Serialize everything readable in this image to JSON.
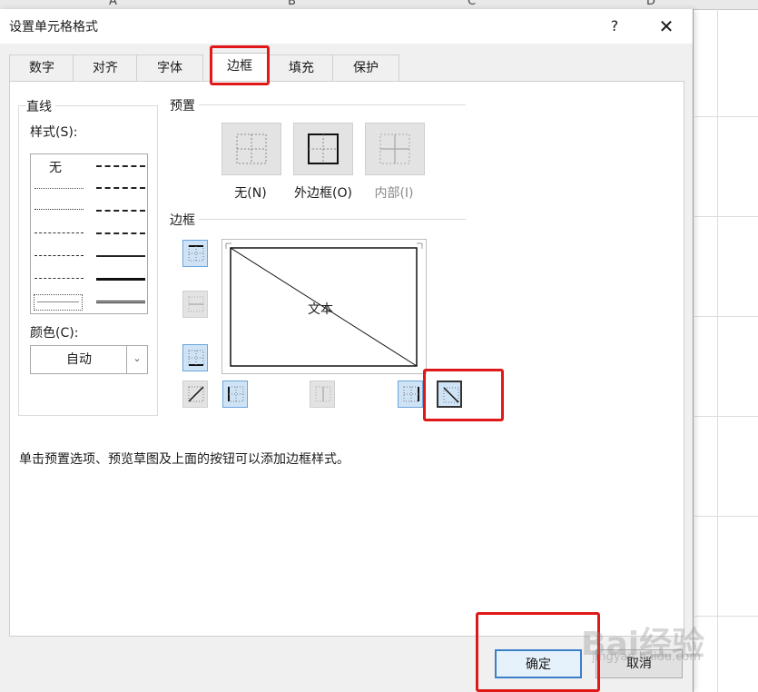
{
  "sheet": {
    "columns": [
      "A",
      "B",
      "C",
      "D"
    ]
  },
  "dialog": {
    "title": "设置单元格格式",
    "help": "?",
    "close": "✕"
  },
  "tabs": [
    {
      "label": "数字"
    },
    {
      "label": "对齐"
    },
    {
      "label": "字体"
    },
    {
      "label": "边框"
    },
    {
      "label": "填充"
    },
    {
      "label": "保护"
    }
  ],
  "line": {
    "group": "直线",
    "style_label": "样式(S):",
    "none": "无",
    "color_label": "颜色(C):",
    "color_value": "自动"
  },
  "presets": {
    "group": "预置",
    "none": "无(N)",
    "outline": "外边框(O)",
    "inside": "内部(I)"
  },
  "border": {
    "group": "边框",
    "preview_text": "文本"
  },
  "hint": "单击预置选项、预览草图及上面的按钮可以添加边框样式。",
  "buttons": {
    "ok": "确定",
    "cancel": "取消"
  },
  "watermark": {
    "main": "Bai经验",
    "sub": "jingyan.baidu.com"
  },
  "colors": {
    "highlight": "#e01818",
    "selected": "#cfe3f7",
    "accent": "#3c7fc9"
  }
}
